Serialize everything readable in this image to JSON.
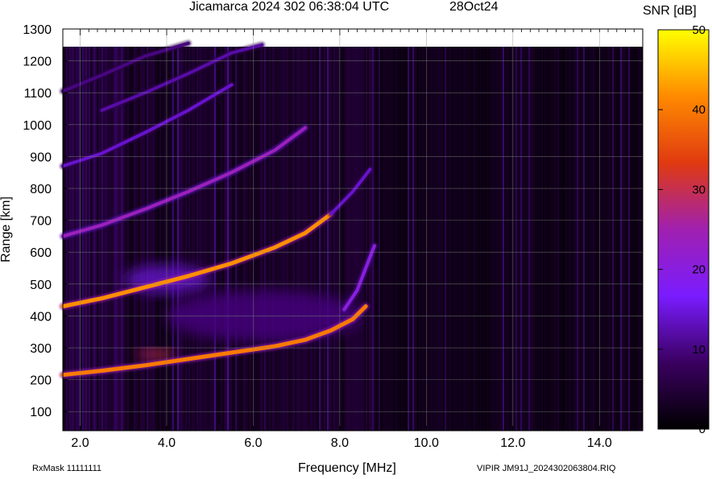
{
  "header": {
    "title": "Jicamarca 2024 302 06:38:04 UTC",
    "date": "28Oct24"
  },
  "colorbar": {
    "label": "SNR [dB]",
    "min": 0,
    "max": 50,
    "ticks": [
      "0",
      "10",
      "20",
      "30",
      "40",
      "50"
    ],
    "colors": [
      "#000000",
      "#3a0060",
      "#7a1cff",
      "#a020b0",
      "#e03a10",
      "#ff8a00",
      "#ffff00"
    ]
  },
  "footer": {
    "left": "RxMask 11111111",
    "right": "VIPIR  JM91J_2024302063804.RIQ"
  },
  "chart_data": {
    "type": "heatmap",
    "xlabel": "Frequency [MHz]",
    "ylabel": "Range [km]",
    "xlim": [
      1.6,
      15.0
    ],
    "ylim": [
      40,
      1300
    ],
    "x_ticks": [
      "2.0",
      "4.0",
      "6.0",
      "8.0",
      "10.0",
      "12.0",
      "14.0"
    ],
    "x_tick_values": [
      2.0,
      4.0,
      6.0,
      8.0,
      10.0,
      12.0,
      14.0
    ],
    "y_ticks": [
      "100",
      "200",
      "300",
      "400",
      "500",
      "600",
      "700",
      "800",
      "900",
      "1000",
      "1100",
      "1200",
      "1300"
    ],
    "y_tick_values": [
      100,
      200,
      300,
      400,
      500,
      600,
      700,
      800,
      900,
      1000,
      1100,
      1200,
      1300
    ],
    "grid": true,
    "traces": [
      {
        "freq": [
          1.6,
          2.5,
          3.5,
          4.5,
          5.5,
          6.5,
          7.2,
          7.8,
          8.3,
          8.6
        ],
        "range": [
          215,
          228,
          245,
          265,
          285,
          305,
          325,
          355,
          390,
          430
        ],
        "snr": 40
      },
      {
        "freq": [
          8.1,
          8.4,
          8.6,
          8.8
        ],
        "range": [
          420,
          480,
          550,
          620
        ],
        "snr": 20
      },
      {
        "freq": [
          1.6,
          2.5,
          3.5,
          4.5,
          5.5,
          6.5,
          7.2,
          7.8
        ],
        "range": [
          430,
          455,
          490,
          525,
          565,
          615,
          660,
          720
        ],
        "snr": 42
      },
      {
        "freq": [
          7.8,
          8.3,
          8.7
        ],
        "range": [
          720,
          790,
          860
        ],
        "snr": 14
      },
      {
        "freq": [
          1.6,
          2.5,
          3.5,
          4.5,
          5.5,
          6.5,
          7.2
        ],
        "range": [
          650,
          685,
          735,
          790,
          850,
          920,
          990
        ],
        "snr": 24
      },
      {
        "freq": [
          1.6,
          2.5,
          3.5,
          4.5,
          5.5
        ],
        "range": [
          870,
          910,
          975,
          1045,
          1125
        ],
        "snr": 14
      },
      {
        "freq": [
          2.5,
          3.5,
          4.5,
          5.5,
          6.2
        ],
        "range": [
          1045,
          1100,
          1160,
          1225,
          1250
        ],
        "snr": 12
      },
      {
        "freq": [
          1.6,
          2.5,
          3.5,
          4.5
        ],
        "range": [
          1105,
          1155,
          1215,
          1255
        ],
        "snr": 10
      }
    ],
    "diffuse_regions": [
      {
        "freq": [
          3.0,
          5.0
        ],
        "range": [
          470,
          560
        ],
        "snr": 14
      },
      {
        "freq": [
          3.3,
          4.2
        ],
        "range": [
          265,
          295
        ],
        "snr": 30
      },
      {
        "freq": [
          4.0,
          8.5
        ],
        "range": [
          320,
          480
        ],
        "snr": 10
      }
    ]
  }
}
